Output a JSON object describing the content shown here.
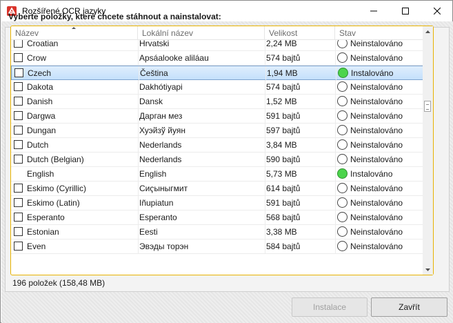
{
  "window": {
    "title": "Rozšířené OCR jazyky"
  },
  "instruction": "Vyberte položky, které chcete stáhnout a nainstalovat:",
  "columns": {
    "name": "Název",
    "local_name": "Lokální název",
    "size": "Velikost",
    "status": "Stav"
  },
  "rows": [
    {
      "name": "Croatian",
      "local_name": "Hrvatski",
      "size": "2,24 MB",
      "status": "Neinstalováno",
      "installed": false,
      "checkbox": true,
      "selected": false
    },
    {
      "name": "Crow",
      "local_name": "Apsáalooke aliláau",
      "size": "574 bajtů",
      "status": "Neinstalováno",
      "installed": false,
      "checkbox": true,
      "selected": false
    },
    {
      "name": "Czech",
      "local_name": "Čeština",
      "size": "1,94 MB",
      "status": "Instalováno",
      "installed": true,
      "checkbox": true,
      "selected": true
    },
    {
      "name": "Dakota",
      "local_name": "Dakhótiyapi",
      "size": "574 bajtů",
      "status": "Neinstalováno",
      "installed": false,
      "checkbox": true,
      "selected": false
    },
    {
      "name": "Danish",
      "local_name": "Dansk",
      "size": "1,52 MB",
      "status": "Neinstalováno",
      "installed": false,
      "checkbox": true,
      "selected": false
    },
    {
      "name": "Dargwa",
      "local_name": "Дарган мез",
      "size": "591 bajtů",
      "status": "Neinstalováno",
      "installed": false,
      "checkbox": true,
      "selected": false
    },
    {
      "name": "Dungan",
      "local_name": "Хуэйзў йуян",
      "size": "597 bajtů",
      "status": "Neinstalováno",
      "installed": false,
      "checkbox": true,
      "selected": false
    },
    {
      "name": "Dutch",
      "local_name": "Nederlands",
      "size": "3,84 MB",
      "status": "Neinstalováno",
      "installed": false,
      "checkbox": true,
      "selected": false
    },
    {
      "name": "Dutch (Belgian)",
      "local_name": "Nederlands",
      "size": "590 bajtů",
      "status": "Neinstalováno",
      "installed": false,
      "checkbox": true,
      "selected": false
    },
    {
      "name": "English",
      "local_name": "English",
      "size": "5,73 MB",
      "status": "Instalováno",
      "installed": true,
      "checkbox": false,
      "selected": false
    },
    {
      "name": "Eskimo (Cyrillic)",
      "local_name": "Сиҁыныгмит",
      "size": "614 bajtů",
      "status": "Neinstalováno",
      "installed": false,
      "checkbox": true,
      "selected": false
    },
    {
      "name": "Eskimo (Latin)",
      "local_name": "Iñupiatun",
      "size": "591 bajtů",
      "status": "Neinstalováno",
      "installed": false,
      "checkbox": true,
      "selected": false
    },
    {
      "name": "Esperanto",
      "local_name": "Esperanto",
      "size": "568 bajtů",
      "status": "Neinstalováno",
      "installed": false,
      "checkbox": true,
      "selected": false
    },
    {
      "name": "Estonian",
      "local_name": "Eesti",
      "size": "3,38 MB",
      "status": "Neinstalováno",
      "installed": false,
      "checkbox": true,
      "selected": false
    },
    {
      "name": "Even",
      "local_name": "Эвэды торэн",
      "size": "584 bajtů",
      "status": "Neinstalováno",
      "installed": false,
      "checkbox": true,
      "selected": false
    }
  ],
  "item_count": "196 položek (158,48 MB)",
  "buttons": {
    "install": "Instalace",
    "close": "Zavřít"
  },
  "icons": {
    "app": "pdf-ocr-icon",
    "minimize": "minimize-icon",
    "maximize": "maximize-icon",
    "close": "close-icon"
  },
  "colors": {
    "accent_border": "#e7b200",
    "selection": "#c4e0fb",
    "installed": "#4cd44c"
  }
}
